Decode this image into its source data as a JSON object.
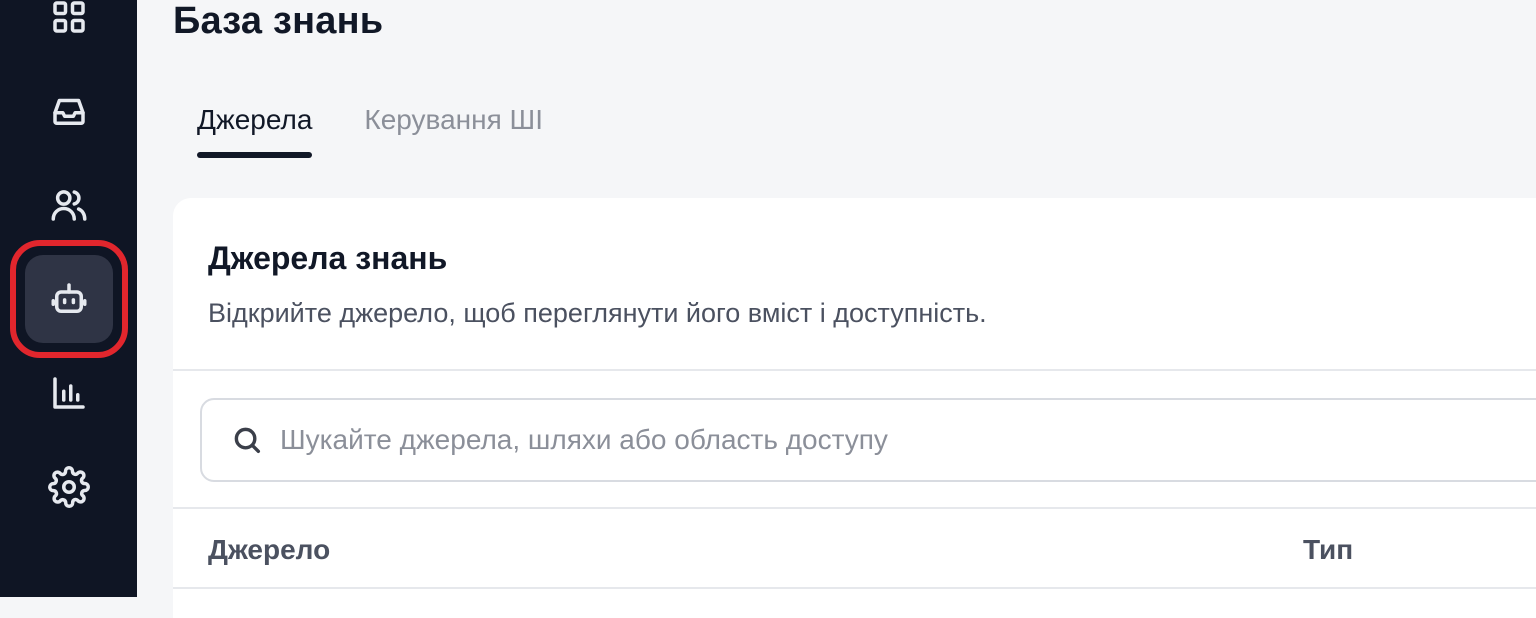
{
  "sidebar": {
    "items": [
      {
        "icon": "dashboard-grid-icon",
        "active": false
      },
      {
        "icon": "inbox-icon",
        "active": false
      },
      {
        "icon": "users-icon",
        "active": false
      },
      {
        "icon": "bot-icon",
        "active": true
      },
      {
        "icon": "bar-chart-icon",
        "active": false
      },
      {
        "icon": "gear-icon",
        "active": false
      }
    ],
    "highlight_color": "#e1262d"
  },
  "header": {
    "title": "База знань"
  },
  "tabs": [
    {
      "label": "Джерела",
      "active": true
    },
    {
      "label": "Керування ШІ",
      "active": false
    }
  ],
  "card": {
    "title": "Джерела знань",
    "subtitle": "Відкрийте джерело, щоб переглянути його вміст і доступність."
  },
  "search": {
    "placeholder": "Шукайте джерела, шляхи або область доступу",
    "value": ""
  },
  "table": {
    "columns": [
      "Джерело",
      "Тип"
    ]
  }
}
